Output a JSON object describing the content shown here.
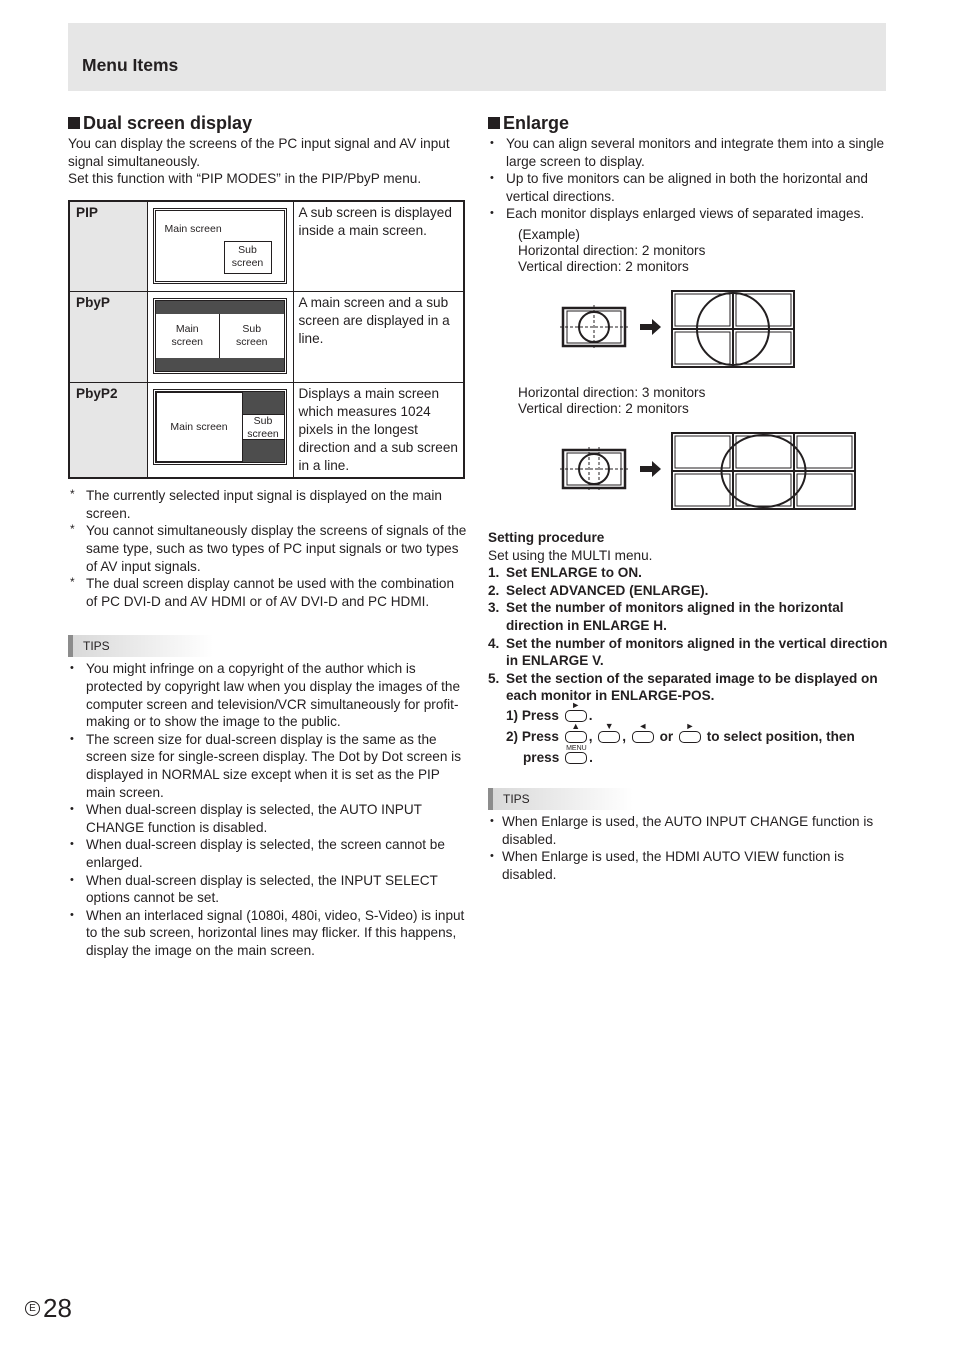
{
  "header": {
    "title": "Menu Items"
  },
  "dual_screen": {
    "heading": "Dual screen display",
    "intro": [
      "You can display the screens of the PC input signal and AV input signal simultaneously.",
      "Set this function with “PIP MODES” in the PIP/PbyP menu."
    ],
    "modes": [
      {
        "name": "PIP",
        "diagram": {
          "main": "Main screen",
          "sub": "Sub screen"
        },
        "description": "A sub screen is displayed inside a main screen."
      },
      {
        "name": "PbyP",
        "diagram": {
          "main": "Main screen",
          "sub": "Sub screen"
        },
        "description": "A main screen and a sub screen are displayed in a line."
      },
      {
        "name": "PbyP2",
        "diagram": {
          "main": "Main screen",
          "sub": "Sub screen"
        },
        "description": "Displays a main screen which measures 1024 pixels in the longest direction and a sub screen in a line."
      }
    ],
    "notes": [
      "The currently selected input signal is displayed on the main screen.",
      "You cannot simultaneously display the screens of signals of the same type, such as two types of PC input signals or two types of AV input signals.",
      "The dual screen display cannot be used with the combination of PC DVI-D and AV HDMI or of AV DVI-D and PC HDMI."
    ],
    "tips_label": "TIPS",
    "tips": [
      "You might infringe on a copyright of the author which is protected by copyright law when you display the images of the computer screen and television/VCR simultaneously for profit-making or to show the image to the public.",
      "The screen size for dual-screen display is the same as the screen size for single-screen display. The Dot by Dot screen is displayed in NORMAL size except when it is set as the PIP main screen.",
      "When dual-screen display is selected, the AUTO INPUT CHANGE function is disabled.",
      "When dual-screen display is selected, the screen cannot be enlarged.",
      "When dual-screen display is selected, the INPUT SELECT options cannot be set.",
      "When an interlaced signal (1080i, 480i, video, S-Video) is input to the sub screen, horizontal lines may flicker. If this happens, display the image on the main screen."
    ]
  },
  "enlarge": {
    "heading": "Enlarge",
    "bullets": [
      "You can align several monitors and integrate them into a single large screen to display.",
      "Up to five monitors can be aligned in both the horizontal and vertical directions.",
      "Each monitor displays enlarged views of separated images."
    ],
    "example_label": "(Example)",
    "examples": [
      {
        "horizontal": "Horizontal direction: 2 monitors",
        "vertical": "Vertical direction: 2 monitors",
        "cols": 2,
        "rows": 2
      },
      {
        "horizontal": "Horizontal direction: 3 monitors",
        "vertical": "Vertical direction: 2 monitors",
        "cols": 3,
        "rows": 2
      }
    ],
    "procedure": {
      "heading": "Setting procedure",
      "intro": "Set using the MULTI menu.",
      "steps": [
        {
          "num": "1.",
          "text": "Set ENLARGE to ON."
        },
        {
          "num": "2.",
          "text": "Select ADVANCED (ENLARGE)."
        },
        {
          "num": "3.",
          "text": "Set the number of monitors aligned in the horizontal direction in ENLARGE H."
        },
        {
          "num": "4.",
          "text": "Set the number of monitors aligned in the vertical direction in ENLARGE V."
        },
        {
          "num": "5.",
          "text": "Set the section of the separated image to be displayed on each monitor in ENLARGE-POS."
        }
      ],
      "substep1": {
        "prefix": "1) Press",
        "suffix": "."
      },
      "substep2": {
        "prefix": "2) Press",
        "sep1": ",",
        "sep2": ",",
        "or": "or",
        "suffix": "to select position, then",
        "press": "press",
        "end": "."
      },
      "keys": {
        "up": "▲",
        "down": "▼",
        "left": "◄",
        "right": "►",
        "menu": "MENU"
      }
    },
    "tips_label": "TIPS",
    "tips": [
      "When Enlarge is used, the AUTO INPUT CHANGE function is disabled.",
      "When Enlarge is used, the HDMI AUTO VIEW function is disabled."
    ]
  },
  "footer": {
    "lang_mark": "E",
    "page_number": "28"
  }
}
